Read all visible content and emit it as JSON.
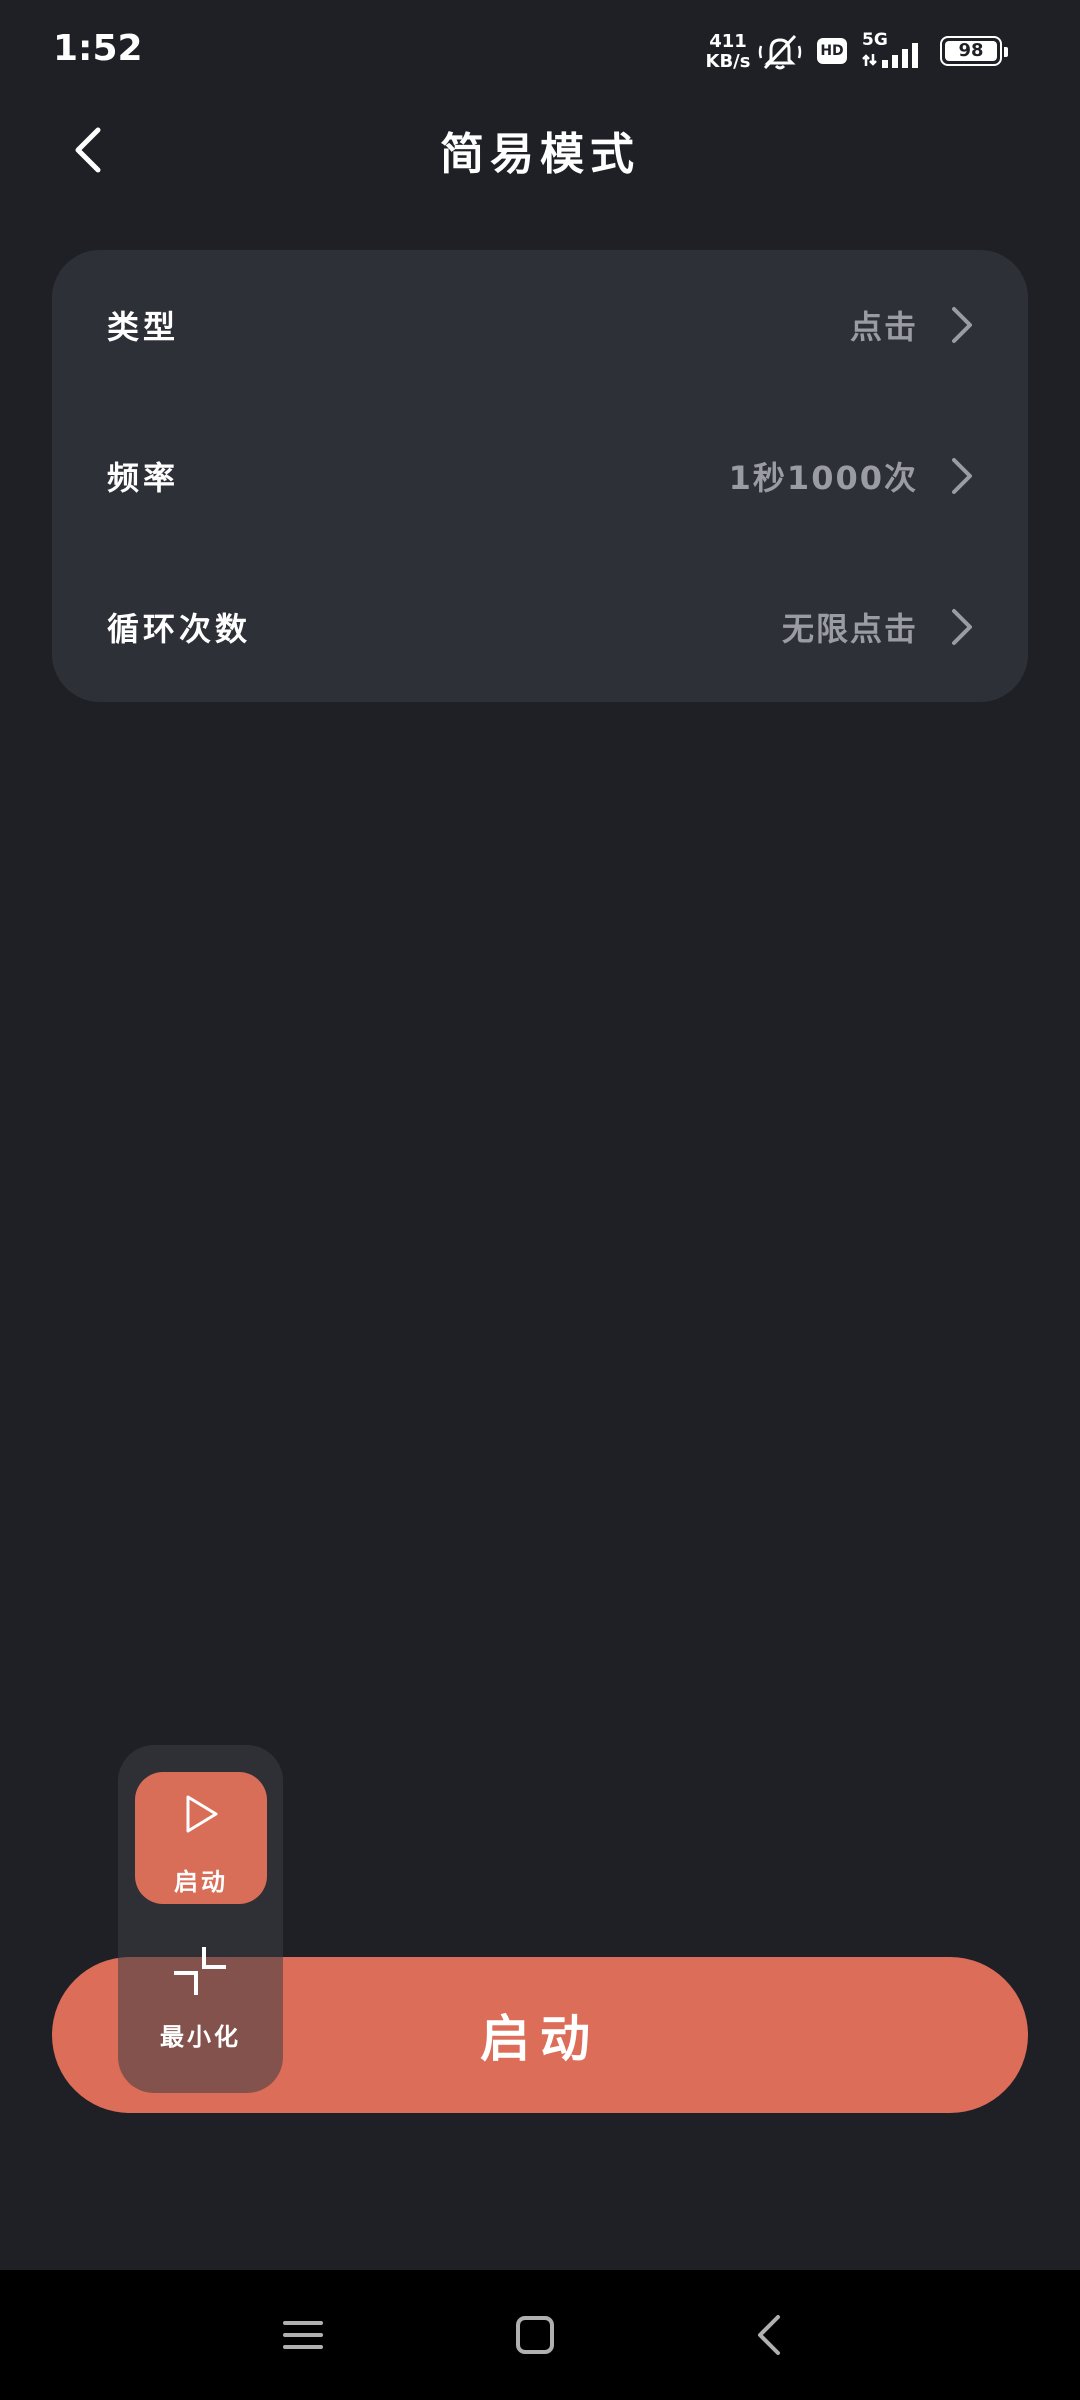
{
  "status_bar": {
    "time": "1:52",
    "net_speed_value": "411",
    "net_speed_unit": "KB/s",
    "hd_label": "HD",
    "network_label": "5G",
    "battery_percent": "98",
    "icons": [
      "mute-bell-icon",
      "hd-icon",
      "signal-icon",
      "battery-icon"
    ]
  },
  "header": {
    "title": "简易模式",
    "back_icon": "chevron-left-icon"
  },
  "settings": [
    {
      "label": "类型",
      "value": "点击"
    },
    {
      "label": "频率",
      "value": "1秒1000次"
    },
    {
      "label": "循环次数",
      "value": "无限点击"
    }
  ],
  "float_panel": {
    "start_label": "启动",
    "start_icon": "play-icon",
    "minimize_label": "最小化",
    "minimize_icon": "minimize-icon"
  },
  "main_button": {
    "label": "启动"
  },
  "nav_bar": {
    "icons": [
      "menu-icon",
      "home-icon",
      "back-icon"
    ]
  },
  "colors": {
    "background": "#1f2026",
    "card": "#2e3038",
    "accent": "#dc6d58",
    "secondary_text": "#9b9ca3",
    "nav_bar": "#000000"
  }
}
